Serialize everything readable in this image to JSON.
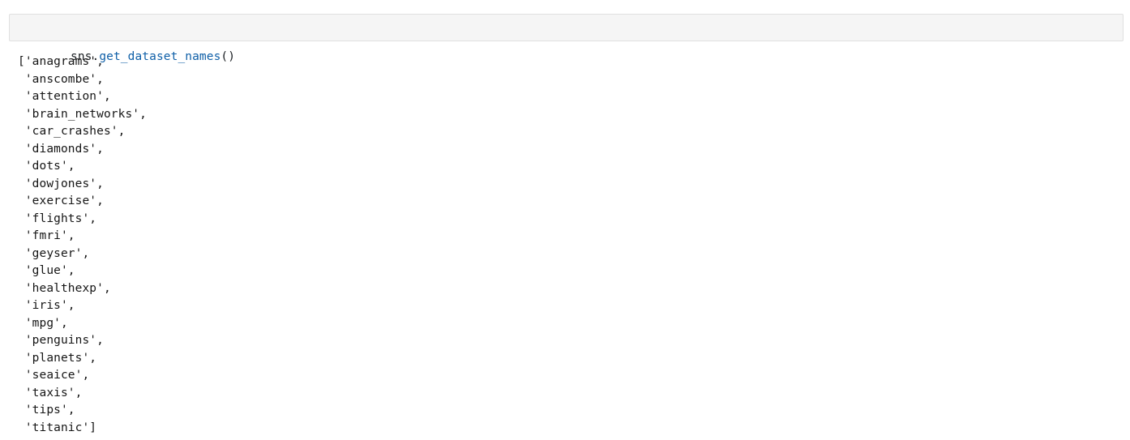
{
  "input_cell": {
    "prompt": "[",
    "code_tokens": [
      {
        "text": "sns.",
        "kind": "name"
      },
      {
        "text": "get_dataset_names",
        "kind": "func"
      },
      {
        "text": "()",
        "kind": "punct"
      }
    ],
    "code_text": "sns.get_dataset_names()"
  },
  "output_cell": {
    "prompt": "[",
    "open_bracket": "[",
    "close_bracket": "]",
    "lines": [
      "['anagrams',",
      " 'anscombe',",
      " 'attention',",
      " 'brain_networks',",
      " 'car_crashes',",
      " 'diamonds',",
      " 'dots',",
      " 'dowjones',",
      " 'exercise',",
      " 'flights',",
      " 'fmri',",
      " 'geyser',",
      " 'glue',",
      " 'healthexp',",
      " 'iris',",
      " 'mpg',",
      " 'penguins',",
      " 'planets',",
      " 'seaice',",
      " 'taxis',",
      " 'tips',",
      " 'titanic']"
    ],
    "dataset_names": [
      "anagrams",
      "anscombe",
      "attention",
      "brain_networks",
      "car_crashes",
      "diamonds",
      "dots",
      "dowjones",
      "exercise",
      "flights",
      "fmri",
      "geyser",
      "glue",
      "healthexp",
      "iris",
      "mpg",
      "penguins",
      "planets",
      "seaice",
      "taxis",
      "tips",
      "titanic"
    ]
  },
  "colors": {
    "cell_background": "#f5f5f5",
    "cell_border": "#e0e0e0",
    "code_name": "#1b1f23",
    "code_function": "#1060a8",
    "output_text": "#161616",
    "page_background": "#ffffff"
  }
}
